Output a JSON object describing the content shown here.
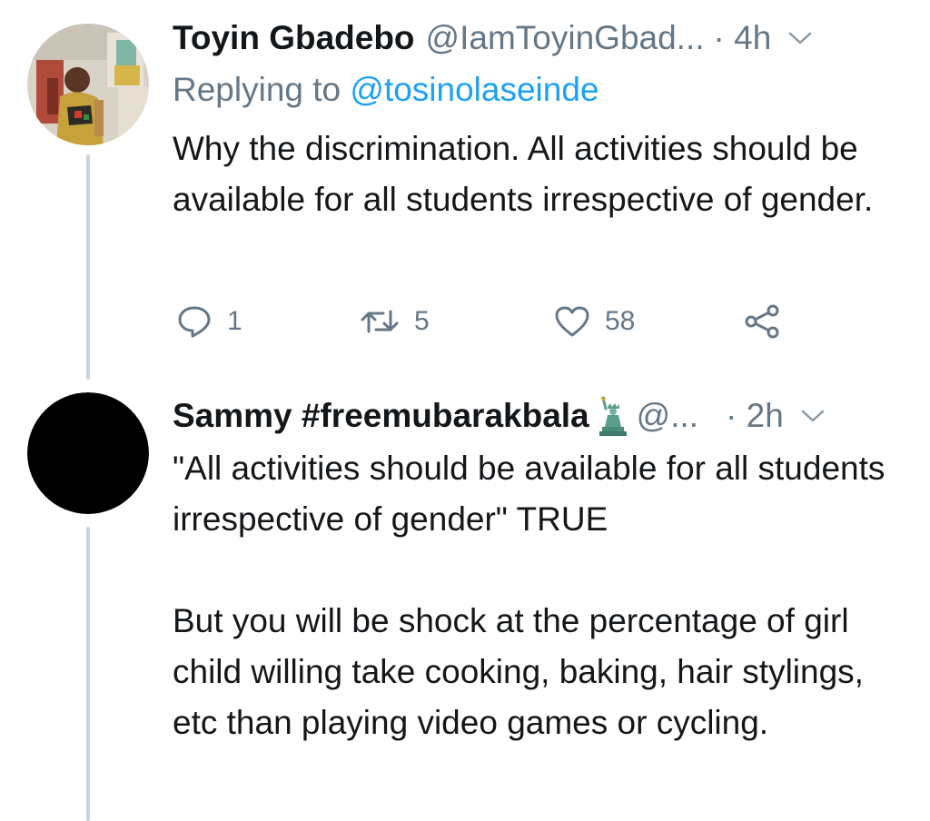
{
  "tweets": [
    {
      "name": "Toyin Gbadebo",
      "handle": "@IamToyinGbad...",
      "time": "· 4h",
      "avatar_icon": "user-photo-avatar",
      "replying_prefix": "Replying to ",
      "replying_to": "@tosinolaseinde",
      "text": "Why the discrimination. All activities should be available for all students irrespective of gender.",
      "actions": {
        "reply_count": "1",
        "retweet_count": "5",
        "like_count": "58"
      }
    },
    {
      "name": "Sammy #freemubarakbala",
      "name_emoji": "statue-of-liberty-emoji",
      "handle": "@...",
      "time": "· 2h",
      "avatar_icon": "black-circle-avatar",
      "text": "\"All activities should be available for all students irrespective of gender\" TRUE\n\nBut you will be shock at the percentage of girl child willing take cooking, baking, hair stylings, etc than playing video games or cycling."
    }
  ],
  "colors": {
    "text": "#14171a",
    "secondary": "#657786",
    "link": "#1da1f2",
    "thread_line": "#c9d4dc"
  }
}
